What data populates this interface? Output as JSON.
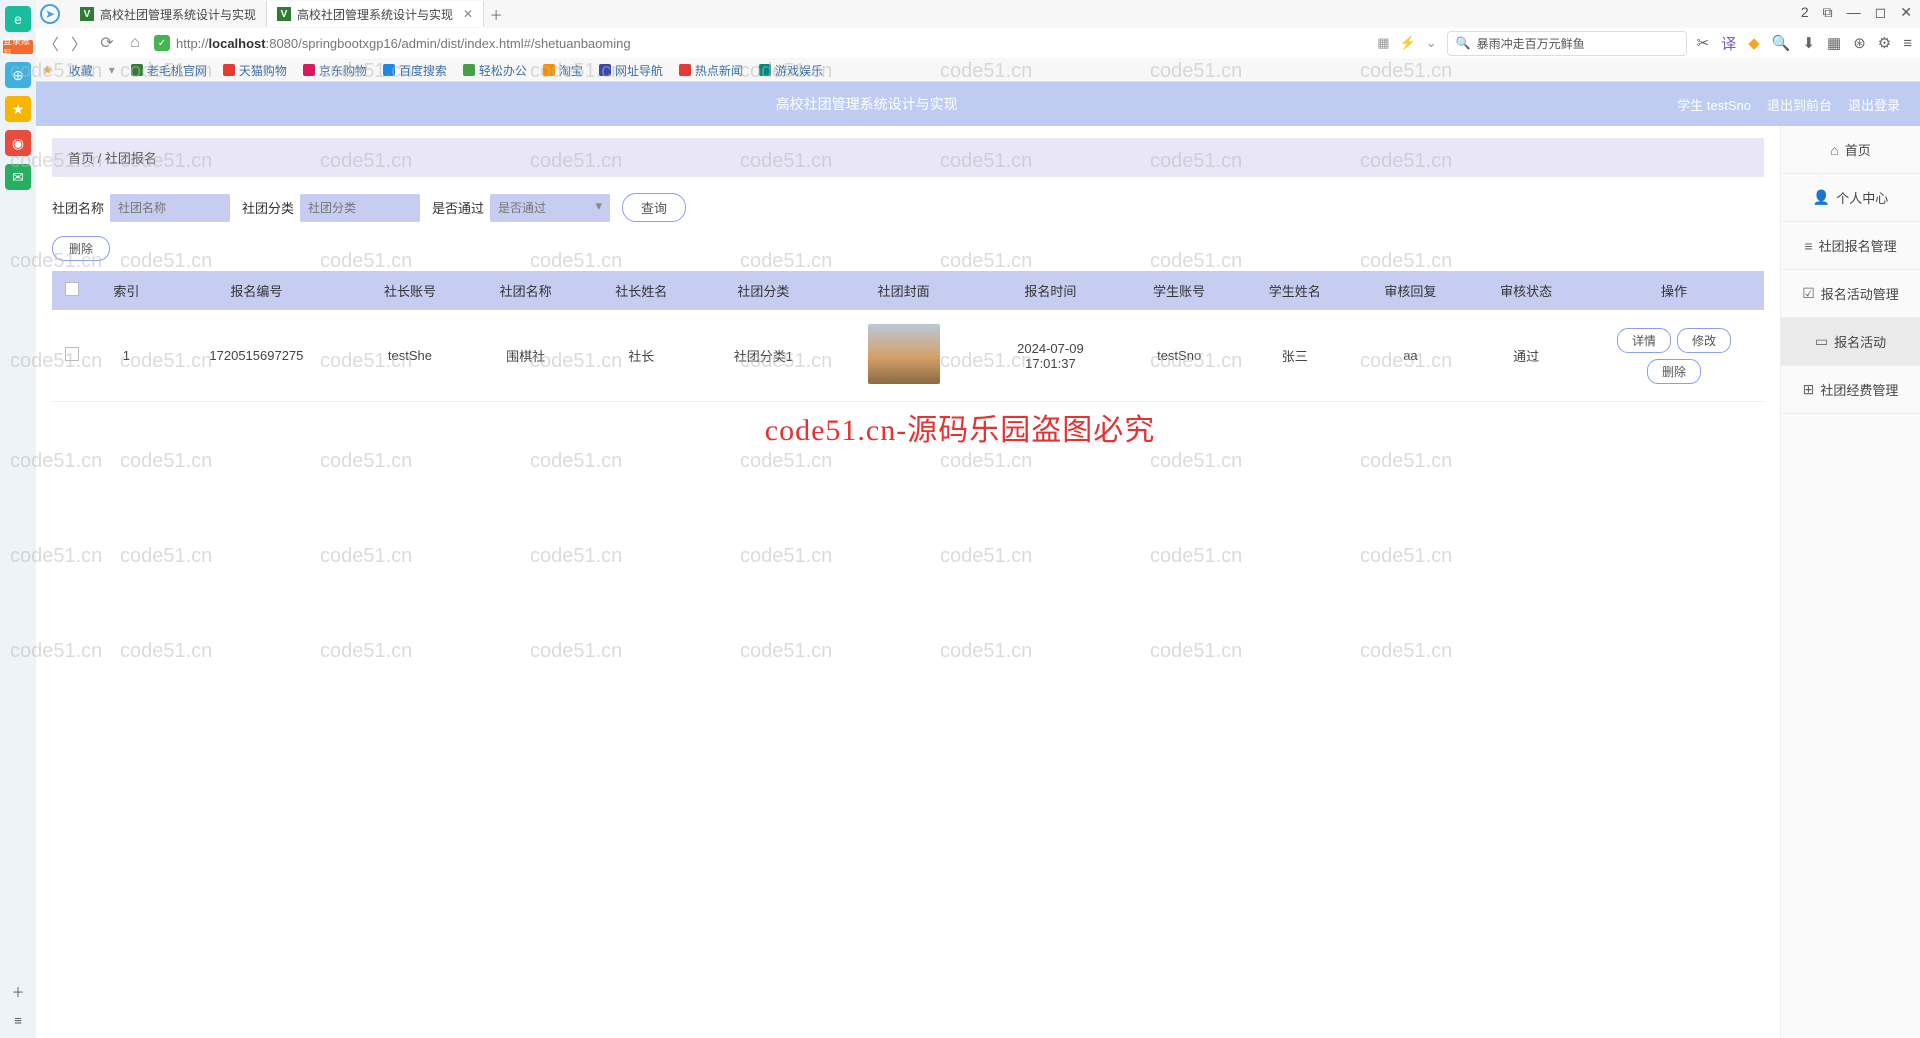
{
  "browser": {
    "tabs": [
      {
        "title": "高校社团管理系统设计与实现"
      },
      {
        "title": "高校社团管理系统设计与实现"
      }
    ],
    "url_prefix": "http://",
    "url_host": "localhost",
    "url_rest": ":8080/springbootxgp16/admin/dist/index.html#/shetuanbaoming",
    "search_placeholder": "暴雨冲走百万元鲜鱼",
    "bookmarks_label": "收藏",
    "bookmarks": [
      {
        "label": "老毛桃官网",
        "color": "#2e7d32"
      },
      {
        "label": "天猫购物",
        "color": "#e53935"
      },
      {
        "label": "京东购物",
        "color": "#d81b60"
      },
      {
        "label": "百度搜索",
        "color": "#1e88e5"
      },
      {
        "label": "轻松办公",
        "color": "#43a047"
      },
      {
        "label": "淘宝",
        "color": "#fb8c00"
      },
      {
        "label": "网址导航",
        "color": "#3949ab"
      },
      {
        "label": "热点新闻",
        "color": "#e53935"
      },
      {
        "label": "游戏娱乐",
        "color": "#00897b"
      }
    ],
    "window_controls": {
      "min": "—",
      "max": "◻",
      "close": "✕",
      "box": "2",
      "puzzle": "⧉"
    }
  },
  "app": {
    "title": "高校社团管理系统设计与实现",
    "user_label": "学生 testSno",
    "logout_front": "退出到前台",
    "logout": "退出登录"
  },
  "breadcrumb": {
    "home": "首页",
    "sep": " / ",
    "current": "社团报名"
  },
  "filters": {
    "club_name_label": "社团名称",
    "club_name_placeholder": "社团名称",
    "club_type_label": "社团分类",
    "club_type_placeholder": "社团分类",
    "pass_label": "是否通过",
    "pass_placeholder": "是否通过",
    "query_btn": "查询"
  },
  "top_delete_btn": "删除",
  "table": {
    "headers": [
      "索引",
      "报名编号",
      "社长账号",
      "社团名称",
      "社长姓名",
      "社团分类",
      "社团封面",
      "报名时间",
      "学生账号",
      "学生姓名",
      "审核回复",
      "审核状态",
      "操作"
    ],
    "rows": [
      {
        "index": "1",
        "apply_no": "1720515697275",
        "leader_acct": "testShe",
        "club_name": "围棋社",
        "leader_name": "社长",
        "club_type": "社团分类1",
        "apply_time_line1": "2024-07-09",
        "apply_time_line2": "17:01:37",
        "student_acct": "testSno",
        "student_name": "张三",
        "review_reply": "aa",
        "review_status": "通过",
        "actions": {
          "detail": "详情",
          "edit": "修改",
          "delete": "删除"
        }
      }
    ]
  },
  "sidemenu": [
    {
      "icon": "⌂",
      "label": "首页"
    },
    {
      "icon": "👤",
      "label": "个人中心"
    },
    {
      "icon": "≡",
      "label": "社团报名管理"
    },
    {
      "icon": "☑",
      "label": "报名活动管理"
    },
    {
      "icon": "▭",
      "label": "报名活动"
    },
    {
      "icon": "⊞",
      "label": "社团经费管理"
    }
  ],
  "watermark_center": "code51.cn-源码乐园盗图必究",
  "watermark_bg": "code51.cn",
  "side_badge": "登录账号"
}
